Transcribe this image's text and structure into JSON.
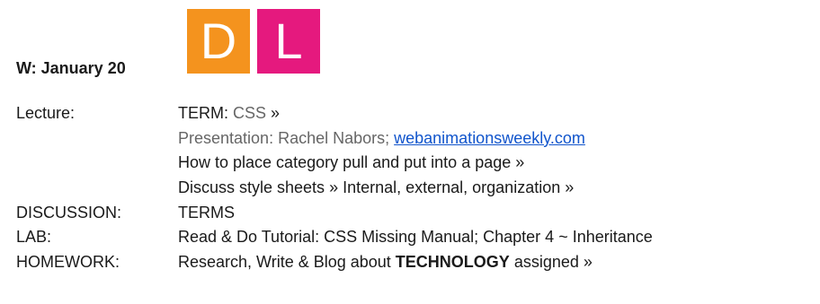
{
  "header": {
    "date": "W: January 20",
    "logo_letters": [
      "D",
      "L"
    ],
    "logo_colors": [
      "#f4931e",
      "#e5197e"
    ]
  },
  "rows": {
    "lecture": {
      "label": "Lecture:",
      "term_prefix": "TERM: ",
      "term_link": "CSS",
      "term_suffix": " »",
      "presentation_text": "Presentation: Rachel Nabors; ",
      "presentation_link": "webanimationsweekly.com",
      "line3_link": "How to place category pull and put into a page",
      "line3_suffix": " »",
      "line4_link_a": "Discuss style sheets",
      "line4_mid": " » ",
      "line4_link_b": "Internal, external, organization",
      "line4_suffix": " »"
    },
    "discussion": {
      "label": "DISCUSSION:",
      "value": "TERMS"
    },
    "lab": {
      "label": "LAB:",
      "value": "Read & Do Tutorial: CSS Missing Manual; Chapter 4 ~ Inheritance"
    },
    "homework": {
      "label": "HOMEWORK:",
      "prefix": "Research, Write & Blog about ",
      "bold": "TECHNOLOGY",
      "link": " assigned",
      "suffix": " »"
    }
  }
}
